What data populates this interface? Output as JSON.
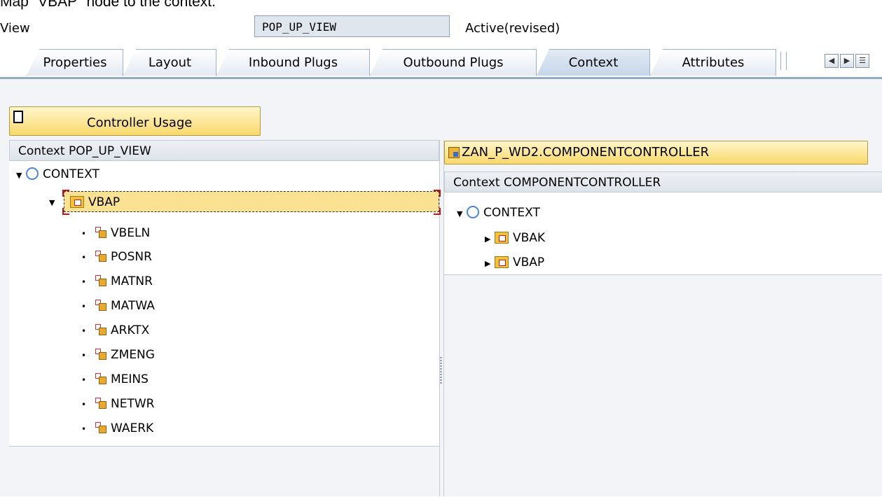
{
  "caption": "Map \"VBAP\" node to the context.",
  "view": {
    "label": "View",
    "name_value": "POP_UP_VIEW",
    "status": "Active(revised)"
  },
  "tabs": [
    {
      "label": "Properties",
      "active": false
    },
    {
      "label": "Layout",
      "active": false
    },
    {
      "label": "Inbound Plugs",
      "active": false
    },
    {
      "label": "Outbound Plugs",
      "active": false
    },
    {
      "label": "Context",
      "active": true
    },
    {
      "label": "Attributes",
      "active": false
    }
  ],
  "tab_nav": {
    "prev_icon": "arrow-left-icon",
    "next_icon": "arrow-right-icon",
    "list_icon": "tab-list-icon"
  },
  "toolbar": {
    "controller_usage_label": "Controller Usage"
  },
  "left_panel": {
    "header": "Context POP_UP_VIEW",
    "root": "CONTEXT",
    "node": "VBAP",
    "attributes": [
      "VBELN",
      "POSNR",
      "MATNR",
      "MATWA",
      "ARKTX",
      "ZMENG",
      "MEINS",
      "NETWR",
      "WAERK"
    ]
  },
  "right_panel": {
    "controller_button": "ZAN_P_WD2.COMPONENTCONTROLLER",
    "header": "Context COMPONENTCONTROLLER",
    "root": "CONTEXT",
    "nodes": [
      "VBAK",
      "VBAP"
    ]
  },
  "colors": {
    "accent_yellow": "#f9d86a",
    "tab_border": "#94aac7",
    "selection_marker": "#d01010",
    "context_ring": "#4d86d8"
  }
}
